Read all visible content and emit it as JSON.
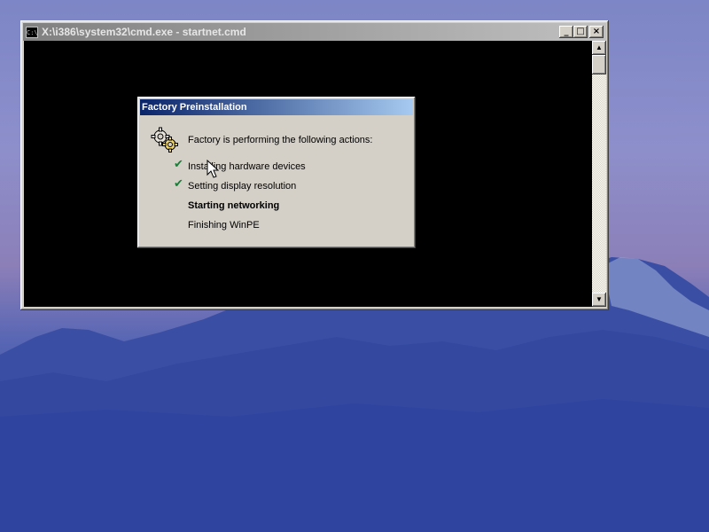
{
  "cmd_window": {
    "icon_text": "C:\\",
    "title": "X:\\i386\\system32\\cmd.exe - startnet.cmd",
    "buttons": {
      "minimize": "_",
      "maximize": "□",
      "close": "×"
    },
    "scroll_up": "▲",
    "scroll_down": "▼"
  },
  "dialog": {
    "title": "Factory Preinstallation",
    "heading": "Factory is performing the following actions:",
    "steps": [
      {
        "label": "Installing hardware devices",
        "status": "done"
      },
      {
        "label": "Setting display resolution",
        "status": "done"
      },
      {
        "label": "Starting networking",
        "status": "in-progress"
      },
      {
        "label": "Finishing WinPE",
        "status": "pending"
      }
    ],
    "check_glyph": "✔"
  },
  "colors": {
    "title_active_start": "#0a246a",
    "title_active_end": "#a6caf0",
    "check_green": "#1f7a3a"
  }
}
